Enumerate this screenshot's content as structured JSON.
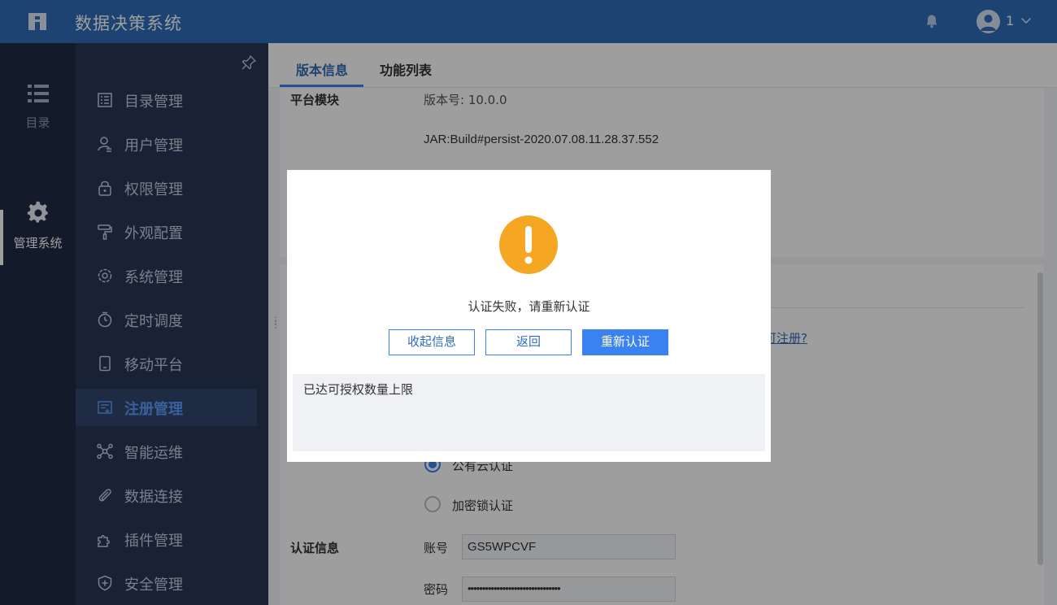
{
  "app": {
    "title": "数据决策系统",
    "user": "1"
  },
  "rail": [
    {
      "label": "目录",
      "icon": "list-icon"
    },
    {
      "label": "管理系统",
      "icon": "gear-icon"
    }
  ],
  "menu": [
    {
      "label": "目录管理",
      "icon": "catalog-icon"
    },
    {
      "label": "用户管理",
      "icon": "user-icon"
    },
    {
      "label": "权限管理",
      "icon": "lock-icon"
    },
    {
      "label": "外观配置",
      "icon": "paint-roller-icon"
    },
    {
      "label": "系统管理",
      "icon": "settings-icon"
    },
    {
      "label": "定时调度",
      "icon": "timer-icon"
    },
    {
      "label": "移动平台",
      "icon": "mobile-icon"
    },
    {
      "label": "注册管理",
      "icon": "register-icon",
      "active": true
    },
    {
      "label": "智能运维",
      "icon": "network-icon"
    },
    {
      "label": "数据连接",
      "icon": "paperclip-icon"
    },
    {
      "label": "插件管理",
      "icon": "puzzle-icon"
    },
    {
      "label": "安全管理",
      "icon": "shield-icon"
    }
  ],
  "tabs": [
    {
      "label": "版本信息",
      "active": true
    },
    {
      "label": "功能列表"
    }
  ],
  "background": {
    "platform_label": "平台模块",
    "version_text": "版本号: 10.0.0",
    "jar_build": "JAR:Build#persist-2020.07.08.11.28.37.552",
    "register_link": "可注册?",
    "radio_cloud": "公有云认证",
    "radio_lock": "加密锁认证",
    "auth_label": "认证信息",
    "account_label": "账号",
    "account_value": "GS5WPCVF",
    "password_label": "密码",
    "password_value": "••••••••••••••••••••••••••••••••"
  },
  "dialog": {
    "message": "认证失败，请重新认证",
    "collapse_label": "收起信息",
    "back_label": "返回",
    "reauth_label": "重新认证",
    "detail": "已达可授权数量上限"
  },
  "colors": {
    "header": "#2f6cba",
    "rail": "#1f2d46",
    "menu": "#273754",
    "accent": "#3a82f2",
    "warning": "#f5a623"
  }
}
